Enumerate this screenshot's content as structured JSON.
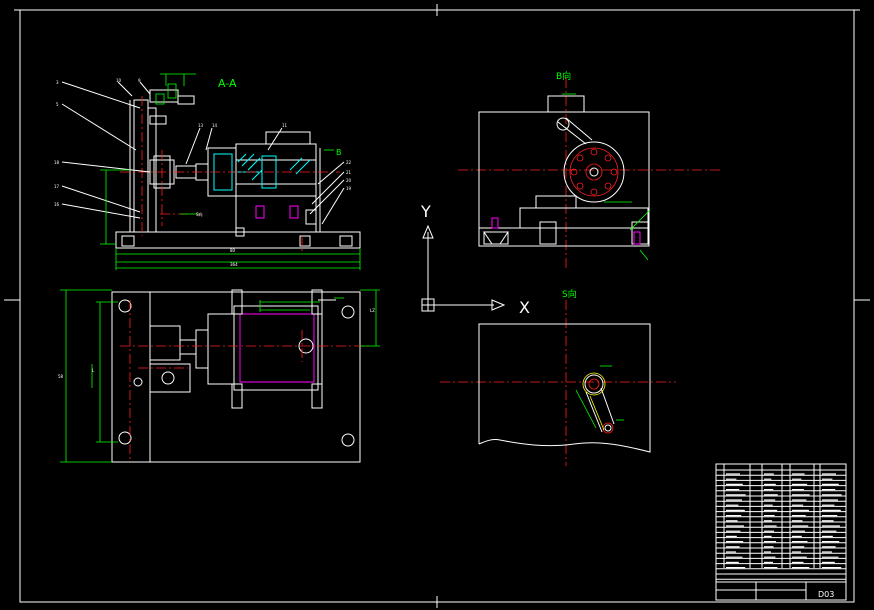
{
  "views": {
    "section_label": "A-A",
    "b_arrow_label": "B",
    "s_arrow_label": "S向",
    "b_view_label": "B向",
    "s_view_label": "S向"
  },
  "axes": {
    "y_label": "Y",
    "x_label": "X"
  },
  "title_block": {
    "drawing_number": "D03"
  },
  "colors": {
    "background": "#000000",
    "outline": "#ffffff",
    "dimension": "#00ff00",
    "centerline": "#ff2020",
    "cylinder": "#00ffff",
    "bolt": "#ff00ff"
  }
}
